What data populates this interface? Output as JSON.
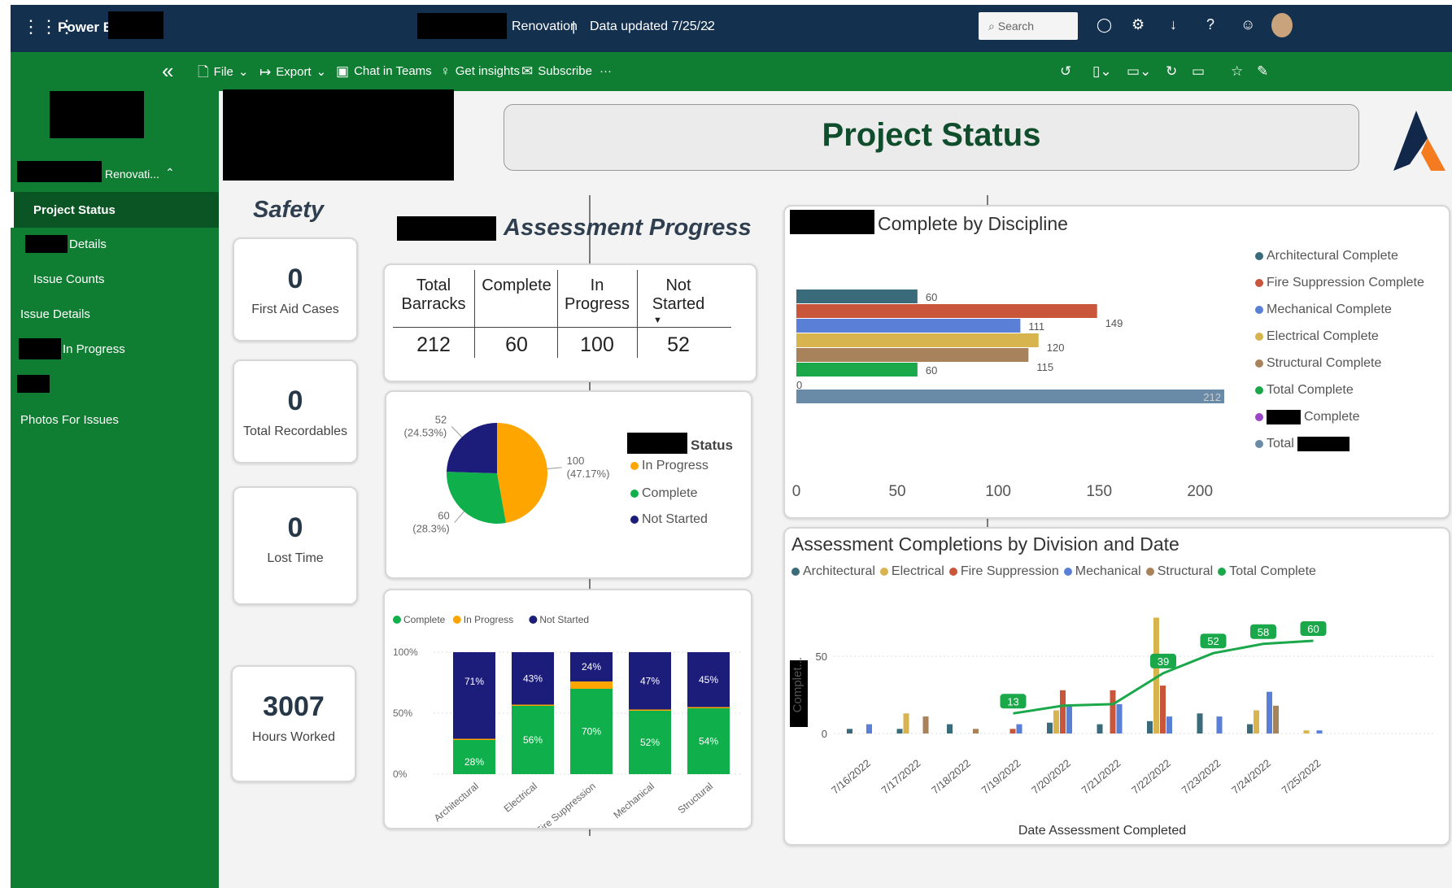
{
  "app": {
    "name": "Power BI",
    "report_name": "Renovation",
    "data_updated": "Data updated 7/25/22",
    "search_placeholder": "Search"
  },
  "toolbar": {
    "file": "File",
    "export": "Export",
    "chat": "Chat in Teams",
    "insights": "Get insights",
    "subscribe": "Subscribe",
    "more": "···"
  },
  "sidebar": {
    "workspace": "Renovati...",
    "items": [
      {
        "label": "Project Status",
        "active": true
      },
      {
        "label": "Details"
      },
      {
        "label": "Issue Counts"
      },
      {
        "label": "Issue Details"
      },
      {
        "label": "In Progress"
      },
      {
        "label": "Photos For Issues"
      }
    ]
  },
  "header": {
    "title": "Project Status"
  },
  "safety": {
    "title": "Safety",
    "kpis": [
      {
        "value": "0",
        "label": "First Aid Cases"
      },
      {
        "value": "0",
        "label": "Total Recordables"
      },
      {
        "value": "0",
        "label": "Lost Time"
      },
      {
        "value": "3007",
        "label": "Hours Worked"
      }
    ]
  },
  "assessment": {
    "title": "Assessment Progress",
    "table": {
      "headers": [
        "Total Barracks",
        "Complete",
        "In Progress",
        "Not Started"
      ],
      "values": [
        "212",
        "60",
        "100",
        "52"
      ]
    }
  },
  "colors": {
    "in_progress": "#ffa500",
    "complete": "#0fb04b",
    "not_started": "#1c1c7a",
    "architectural": "#3a6b7a",
    "fire": "#c9553a",
    "mechanical": "#5a7fd6",
    "electrical": "#d8b44e",
    "structural": "#a8825a",
    "total_complete": "#1aa84b",
    "complete_purple": "#9b45c9",
    "total": "#6a8ba8",
    "brand_green": "#0f7d32",
    "topbar": "#13304f"
  },
  "chart_data": [
    {
      "type": "pie",
      "legend_title": "Status",
      "legend": [
        "In Progress",
        "Complete",
        "Not Started"
      ],
      "slices": [
        {
          "name": "In Progress",
          "value": 100,
          "label": "100",
          "pct": "(47.17%)"
        },
        {
          "name": "Complete",
          "value": 60,
          "label": "60",
          "pct": "(28.3%)"
        },
        {
          "name": "Not Started",
          "value": 52,
          "label": "52",
          "pct": "(24.53%)"
        }
      ]
    },
    {
      "type": "bar",
      "stacked": "percent",
      "legend": [
        "Complete",
        "In Progress",
        "Not Started"
      ],
      "categories": [
        "Architectural",
        "Electrical",
        "Fire Suppression",
        "Mechanical",
        "Structural"
      ],
      "y_ticks": [
        "100%",
        "50%",
        "0%"
      ],
      "series": [
        {
          "name": "Complete",
          "values": [
            28,
            56,
            70,
            52,
            54
          ],
          "labels": [
            "28%",
            "56%",
            "70%",
            "52%",
            "54%"
          ]
        },
        {
          "name": "In Progress",
          "values": [
            1,
            1,
            6,
            1,
            1
          ]
        },
        {
          "name": "Not Started",
          "values": [
            71,
            43,
            24,
            47,
            45
          ],
          "labels": [
            "71%",
            "43%",
            "24%",
            "47%",
            "45%"
          ]
        }
      ]
    },
    {
      "type": "bar",
      "orientation": "horizontal",
      "title_suffix": "Complete by Discipline",
      "legend": [
        "Architectural Complete",
        "Fire Suppression Complete",
        "Mechanical Complete",
        "Electrical Complete",
        "Structural Complete",
        "Total Complete",
        "Complete",
        "Total"
      ],
      "values": [
        60,
        149,
        111,
        120,
        115,
        60,
        0,
        212
      ],
      "labels": [
        "60",
        "149",
        "111",
        "120",
        "115",
        "60",
        "0",
        "212"
      ],
      "x_ticks": [
        "0",
        "50",
        "100",
        "150",
        "200"
      ],
      "xlim": [
        0,
        212
      ]
    },
    {
      "type": "bar",
      "title": "Assessment Completions by Division and Date",
      "xlabel": "Date Assessment Completed",
      "ylabel": "Complet...",
      "legend": [
        "Architectural",
        "Electrical",
        "Fire Suppression",
        "Mechanical",
        "Structural",
        "Total Complete"
      ],
      "categories": [
        "7/16/2022",
        "7/17/2022",
        "7/18/2022",
        "7/19/2022",
        "7/20/2022",
        "7/21/2022",
        "7/22/2022",
        "7/23/2022",
        "7/24/2022",
        "7/25/2022"
      ],
      "y_ticks": [
        "0",
        "50"
      ],
      "ylim": [
        0,
        80
      ],
      "series": [
        {
          "name": "Architectural",
          "values": [
            3,
            3,
            6,
            0,
            7,
            6,
            8,
            13,
            6,
            0
          ]
        },
        {
          "name": "Electrical",
          "values": [
            0,
            13,
            0,
            0,
            15,
            0,
            75,
            0,
            15,
            2
          ]
        },
        {
          "name": "Fire Suppression",
          "values": [
            0,
            0,
            0,
            3,
            28,
            28,
            31,
            0,
            0,
            0
          ]
        },
        {
          "name": "Mechanical",
          "values": [
            6,
            0,
            0,
            6,
            18,
            19,
            11,
            11,
            27,
            2
          ]
        },
        {
          "name": "Structural",
          "values": [
            0,
            11,
            3,
            0,
            0,
            0,
            0,
            0,
            18,
            0
          ]
        }
      ],
      "line": {
        "name": "Total Complete",
        "values": [
          null,
          null,
          null,
          13,
          18,
          19,
          39,
          52,
          58,
          60
        ],
        "labels": [
          "",
          "",
          "",
          "13",
          "",
          "",
          "39",
          "52",
          "58",
          "60"
        ]
      },
      "bar_labels": [
        [
          "3",
          "6",
          ""
        ],
        [
          "3",
          "13",
          "11"
        ],
        [
          "6",
          "",
          "3"
        ],
        [
          "6",
          "",
          ""
        ],
        [
          "7",
          "15",
          "18",
          "28"
        ],
        [
          "6",
          "28",
          "19"
        ],
        [
          "8",
          "75",
          "31",
          "11"
        ],
        [
          "13",
          "11"
        ],
        [
          "6",
          "15",
          "27",
          "18"
        ],
        [
          "2",
          "2"
        ]
      ]
    }
  ]
}
